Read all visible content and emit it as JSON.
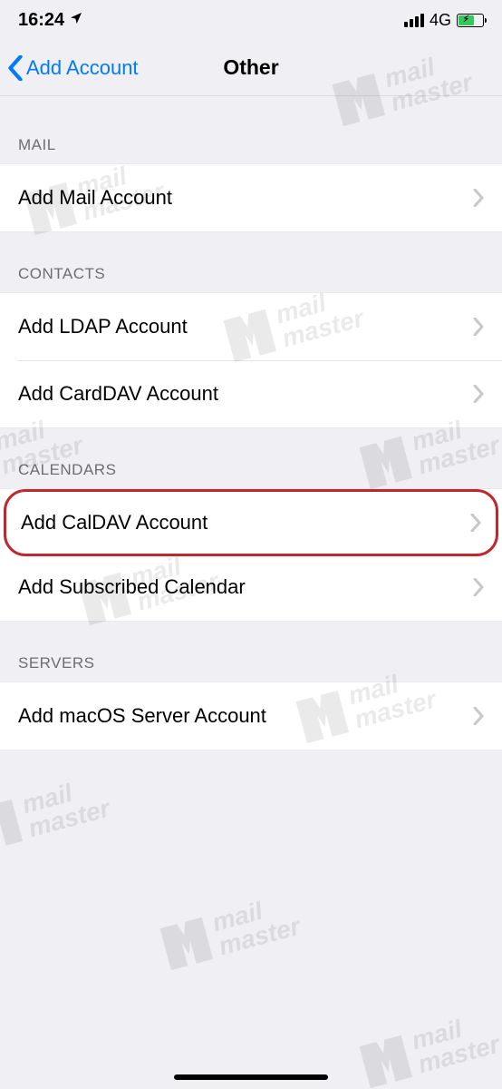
{
  "status": {
    "time": "16:24",
    "network": "4G"
  },
  "nav": {
    "back_label": "Add Account",
    "title": "Other"
  },
  "sections": {
    "mail": {
      "header": "Mail",
      "add_mail": "Add Mail Account"
    },
    "contacts": {
      "header": "Contacts",
      "add_ldap": "Add LDAP Account",
      "add_carddav": "Add CardDAV Account"
    },
    "calendars": {
      "header": "Calendars",
      "add_caldav": "Add CalDAV Account",
      "add_subscribed": "Add Subscribed Calendar"
    },
    "servers": {
      "header": "Servers",
      "add_macos": "Add macOS Server Account"
    }
  },
  "watermark": {
    "line1": "mail",
    "line2": "master"
  }
}
